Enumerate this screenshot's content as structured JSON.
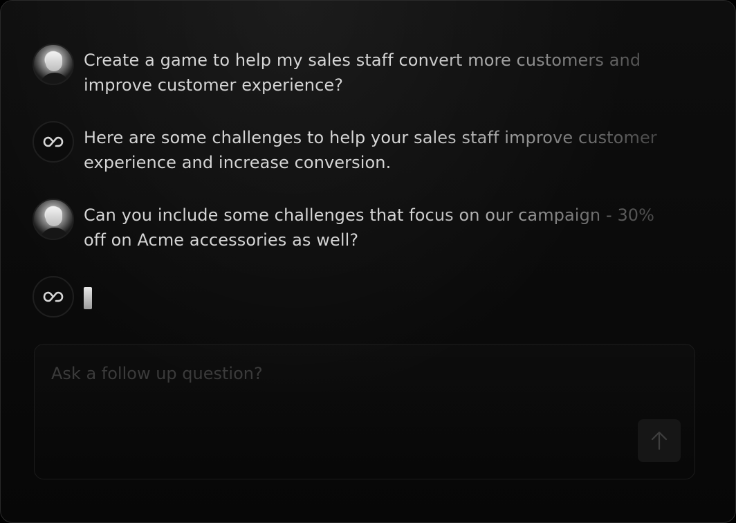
{
  "thread": {
    "messages": [
      {
        "role": "user",
        "text": "Create a game to help my sales staff convert more customers and improve customer experience?"
      },
      {
        "role": "assistant",
        "text": "Here are some challenges to help your sales staff improve customer experience and increase conversion."
      },
      {
        "role": "user",
        "text": "Can you include some challenges that focus on our campaign - 30% off on Acme accessories as well?"
      },
      {
        "role": "assistant",
        "text": ""
      }
    ]
  },
  "composer": {
    "placeholder": "Ask a follow up question?",
    "value": ""
  },
  "icons": {
    "user_avatar": "user-avatar-photo",
    "assistant_avatar": "infinity-logo-icon",
    "send": "arrow-up-icon",
    "typing_cursor": "text-cursor-block"
  },
  "colors": {
    "background": "#0a0a0a",
    "text": "#d6d6d6",
    "placeholder": "#3b3b3b",
    "send_button": "#161616"
  }
}
